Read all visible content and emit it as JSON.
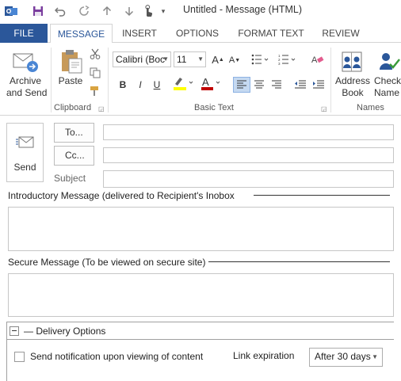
{
  "window": {
    "title": "Untitled - Message (HTML)"
  },
  "tabs": [
    {
      "label": "FILE"
    },
    {
      "label": "MESSAGE"
    },
    {
      "label": "INSERT"
    },
    {
      "label": "OPTIONS"
    },
    {
      "label": "FORMAT TEXT"
    },
    {
      "label": "REVIEW"
    }
  ],
  "ribbon": {
    "archive_label": "Archive",
    "archive_label2": "and Send",
    "paste_label": "Paste",
    "clipboard_group": "Clipboard",
    "font_name": "Calibri (Boc",
    "font_size": "11",
    "basic_text_group": "Basic Text",
    "bold": "B",
    "italic": "I",
    "underline": "U",
    "address_label": "Address",
    "address_label2": "Book",
    "check_label": "Check",
    "check_label2": "Name",
    "names_group": "Names"
  },
  "compose": {
    "send_label": "Send",
    "to_label": "To...",
    "cc_label": "Cc...",
    "subject_label": "Subject",
    "to_value": "",
    "cc_value": "",
    "subject_value": ""
  },
  "intro": {
    "title": "Introductory Message (delivered to Recipient's Inobox",
    "value": ""
  },
  "secure": {
    "title": "Secure Message (To be viewed on secure site)",
    "value": ""
  },
  "delivery": {
    "toggle": "⊟",
    "title": "— Delivery Options",
    "notify_label": "Send notification upon viewing of content",
    "notify_checked": false,
    "expiration_label": "Link expiration",
    "expiration_value": "After 30 days"
  },
  "colors": {
    "file_tab": "#2b579a",
    "accent": "#2b579a",
    "highlight_bar": "#ffff00",
    "font_color_bar": "#c00000",
    "align_active": "#c5d9f1"
  }
}
